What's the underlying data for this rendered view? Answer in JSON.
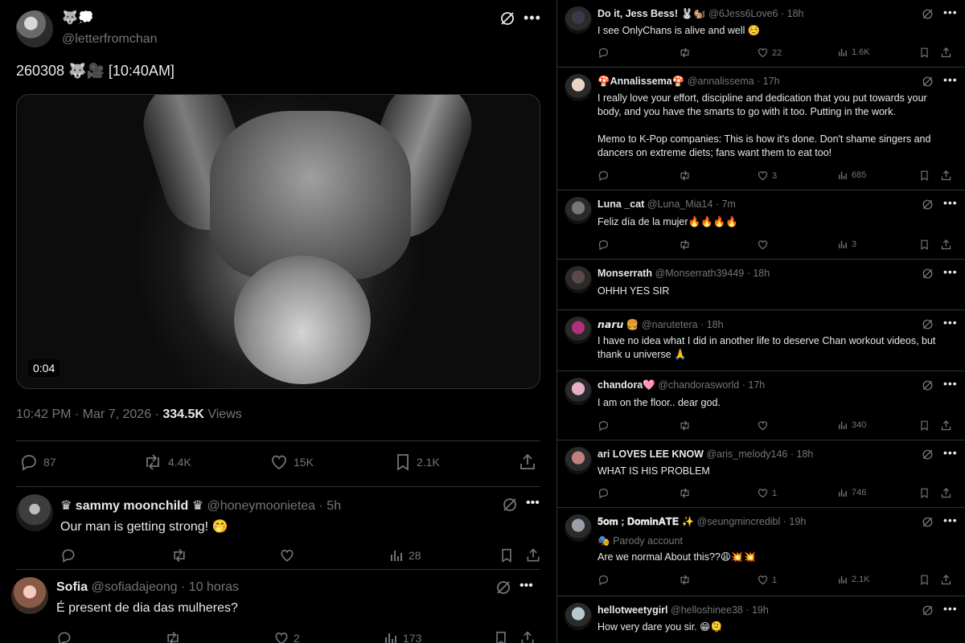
{
  "main_tweet": {
    "name": "🐺💭",
    "handle": "@letterfromchan",
    "text": "260308 🐺🎥 [10:40AM]",
    "video_duration": "0:04",
    "timestamp": "10:42 PM · Mar 7, 2026 · ",
    "views_count": "334.5K",
    "views_label": " Views",
    "stats": {
      "replies": "87",
      "reposts": "4.4K",
      "likes": "15K",
      "bookmarks": "2.1K"
    }
  },
  "left_replies": [
    {
      "name": "♛ sammy moonchild ♛",
      "handle": "@honeymoonietea",
      "time": "· 5h",
      "text": "Our man is getting strong! 🤭",
      "views": "28"
    },
    {
      "name": "Sofia",
      "handle": "@sofiadajeong",
      "time": "· 10 horas",
      "text": "É present de dia das mulheres?",
      "likes": "2",
      "views": "173"
    }
  ],
  "right_replies": [
    {
      "name": "Do it, Jess Bess! 🐰🐿️",
      "handle": "@6Jess6Love6",
      "time": "· 18h",
      "text": "I see OnlyChans is alive and well ☺️",
      "likes": "22",
      "views": "1.6K"
    },
    {
      "name": "🍄Annalissema🍄",
      "handle": "@annalissema",
      "time": "· 17h",
      "text": "I really love your effort, discipline and dedication that you put towards your body, and you have the smarts to go with it too. Putting in the work.\n\nMemo to K-Pop companies: This is how it's done. Don't shame singers and dancers on extreme diets; fans want them to eat too!",
      "likes": "3",
      "views": "685"
    },
    {
      "name": "Luna _cat",
      "handle": "@Luna_Mia14",
      "time": "· 7m",
      "text": "Feliz día de la mujer🔥🔥🔥🔥",
      "likes": "",
      "views": "3"
    },
    {
      "name": "Monserrath",
      "handle": "@Monserrath39449",
      "time": "· 18h",
      "text": "OHHH YES SIR"
    },
    {
      "name": "𝙣𝙖𝙧𝙪 🍔",
      "handle": "@narutetera",
      "time": "· 18h",
      "text": "I have no idea what I did in another life to deserve Chan workout videos, but thank u universe 🙏"
    },
    {
      "name": "chandora🩷",
      "handle": "@chandorasworld",
      "time": "· 17h",
      "text": "I am on the floor.. dear god.",
      "likes": "",
      "views": "340"
    },
    {
      "name": "ari LOVES LEE KNOW",
      "handle": "@aris_melody146",
      "time": "· 18h",
      "text": "WHAT IS HIS PROBLEM",
      "likes": "1",
      "views": "746"
    },
    {
      "name": "𝟓𝐨𝐦 ; 𝐃𝐨𝐦𝐢𝐧𝐀𝐓𝐄 ✨",
      "handle": "@seungmincredibl",
      "time": "· 19h",
      "parody": "Parody account",
      "text": "Are we normal About this??😩💥💥",
      "likes": "1",
      "views": "2.1K"
    },
    {
      "name": "hellotweetygirl",
      "handle": "@helloshinee38",
      "time": "· 19h",
      "text": "How very dare you sir. 😁🫠"
    }
  ],
  "colors": {
    "background": "#000000",
    "text": "#e7e9ea",
    "muted": "#71767b",
    "border": "#2f3336"
  }
}
